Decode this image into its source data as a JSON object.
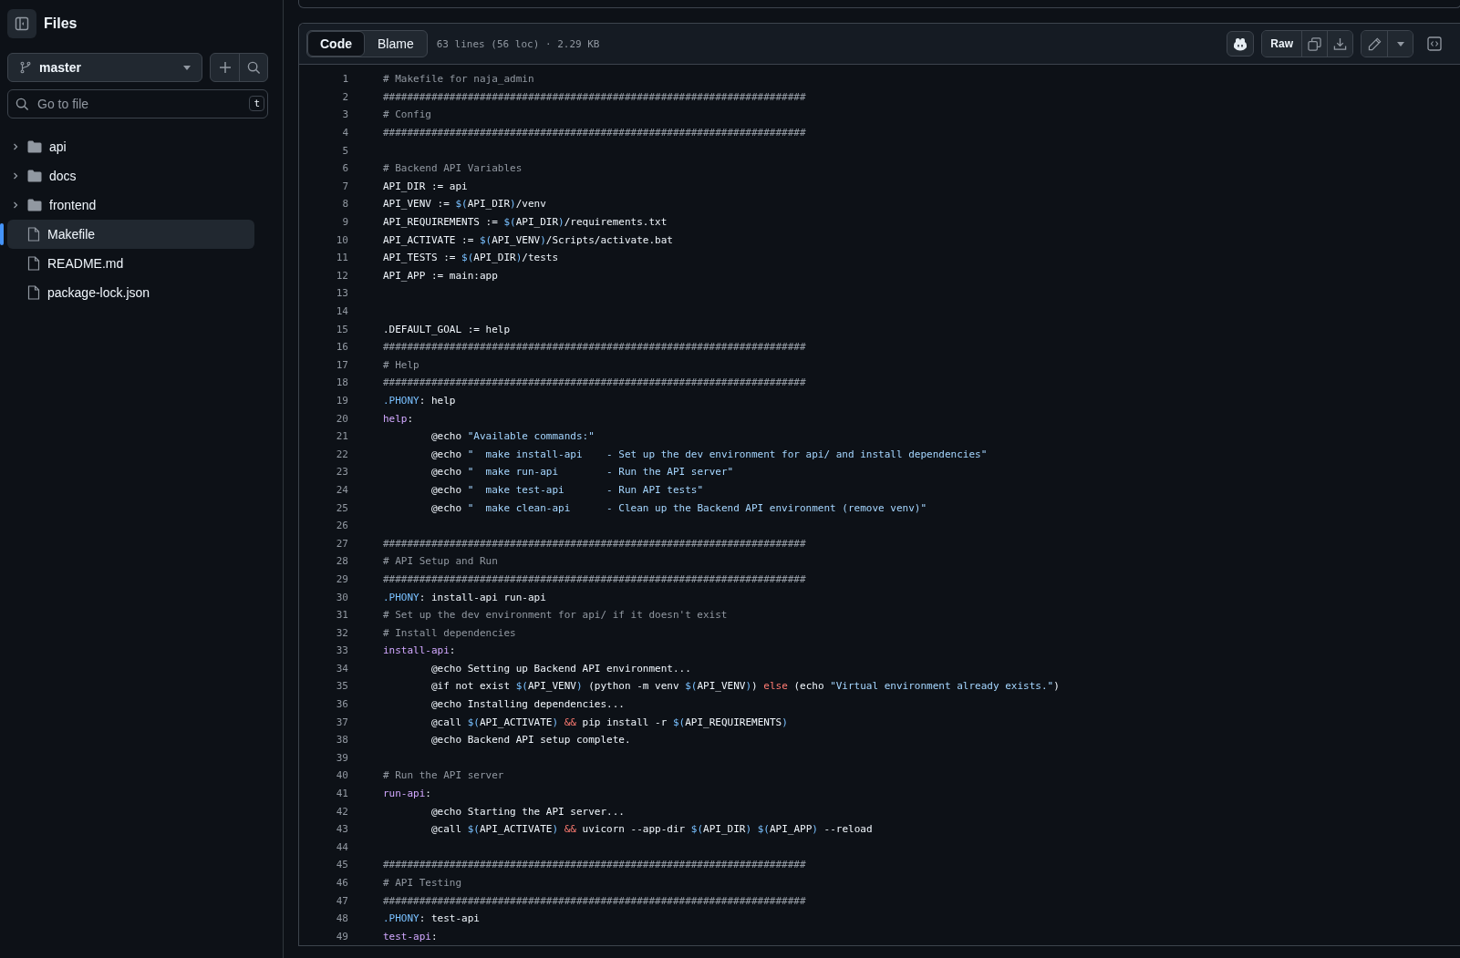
{
  "sidebar": {
    "title": "Files",
    "branch": "master",
    "search": {
      "placeholder": "Go to file",
      "shortcut": "t"
    },
    "items": [
      {
        "name": "api",
        "kind": "folder",
        "expanded": false,
        "selected": false
      },
      {
        "name": "docs",
        "kind": "folder",
        "expanded": false,
        "selected": false
      },
      {
        "name": "frontend",
        "kind": "folder",
        "expanded": false,
        "selected": false
      },
      {
        "name": "Makefile",
        "kind": "file",
        "selected": true
      },
      {
        "name": "README.md",
        "kind": "file",
        "selected": false
      },
      {
        "name": "package-lock.json",
        "kind": "file",
        "selected": false
      }
    ]
  },
  "file": {
    "tabs": [
      {
        "label": "Code",
        "selected": true
      },
      {
        "label": "Blame",
        "selected": false
      }
    ],
    "info": "63 lines (56 loc) · 2.29 KB",
    "raw_button": "Raw",
    "lines": [
      {
        "n": "1",
        "segs": [
          {
            "kind": "comment",
            "t": "# Makefile for naja_admin"
          }
        ]
      },
      {
        "n": "2",
        "segs": [
          {
            "kind": "comment",
            "t": "######################################################################"
          }
        ]
      },
      {
        "n": "3",
        "segs": [
          {
            "kind": "comment",
            "t": "# Config"
          }
        ]
      },
      {
        "n": "4",
        "segs": [
          {
            "kind": "comment",
            "t": "######################################################################"
          }
        ]
      },
      {
        "n": "5"
      },
      {
        "n": "6",
        "segs": [
          {
            "kind": "comment",
            "t": "# Backend API Variables"
          }
        ]
      },
      {
        "n": "7",
        "segs": [
          {
            "kind": "plain",
            "t": "API_DIR := api"
          }
        ]
      },
      {
        "n": "8",
        "segs": [
          {
            "kind": "plain",
            "t": "API_VENV := "
          },
          {
            "kind": "var",
            "t": "$("
          },
          {
            "kind": "plain",
            "t": "API_DIR"
          },
          {
            "kind": "var",
            "t": ")"
          },
          {
            "kind": "plain",
            "t": "/venv"
          }
        ]
      },
      {
        "n": "9",
        "segs": [
          {
            "kind": "plain",
            "t": "API_REQUIREMENTS := "
          },
          {
            "kind": "var",
            "t": "$("
          },
          {
            "kind": "plain",
            "t": "API_DIR"
          },
          {
            "kind": "var",
            "t": ")"
          },
          {
            "kind": "plain",
            "t": "/requirements.txt"
          }
        ]
      },
      {
        "n": "10",
        "segs": [
          {
            "kind": "plain",
            "t": "API_ACTIVATE := "
          },
          {
            "kind": "var",
            "t": "$("
          },
          {
            "kind": "plain",
            "t": "API_VENV"
          },
          {
            "kind": "var",
            "t": ")"
          },
          {
            "kind": "plain",
            "t": "/Scripts/activate.bat"
          }
        ]
      },
      {
        "n": "11",
        "segs": [
          {
            "kind": "plain",
            "t": "API_TESTS := "
          },
          {
            "kind": "var",
            "t": "$("
          },
          {
            "kind": "plain",
            "t": "API_DIR"
          },
          {
            "kind": "var",
            "t": ")"
          },
          {
            "kind": "plain",
            "t": "/tests"
          }
        ]
      },
      {
        "n": "12",
        "segs": [
          {
            "kind": "plain",
            "t": "API_APP := main:app"
          }
        ]
      },
      {
        "n": "13"
      },
      {
        "n": "14"
      },
      {
        "n": "15",
        "segs": [
          {
            "kind": "plain",
            "t": ".DEFAULT_GOAL := help"
          }
        ]
      },
      {
        "n": "16",
        "segs": [
          {
            "kind": "comment",
            "t": "######################################################################"
          }
        ]
      },
      {
        "n": "17",
        "segs": [
          {
            "kind": "comment",
            "t": "# Help"
          }
        ]
      },
      {
        "n": "18",
        "segs": [
          {
            "kind": "comment",
            "t": "######################################################################"
          }
        ]
      },
      {
        "n": "19",
        "segs": [
          {
            "kind": "keyword",
            "t": ".PHONY"
          },
          {
            "kind": "plain",
            "t": ": help"
          }
        ]
      },
      {
        "n": "20",
        "segs": [
          {
            "kind": "target",
            "t": "help"
          },
          {
            "kind": "plain",
            "t": ":"
          }
        ]
      },
      {
        "n": "21",
        "segs": [
          {
            "kind": "plain",
            "t": "\t@echo "
          },
          {
            "kind": "string",
            "t": "\"Available commands:\""
          }
        ]
      },
      {
        "n": "22",
        "segs": [
          {
            "kind": "plain",
            "t": "\t@echo "
          },
          {
            "kind": "string",
            "t": "\"  make install-api    - Set up the dev environment for api/ and install dependencies\""
          }
        ]
      },
      {
        "n": "23",
        "segs": [
          {
            "kind": "plain",
            "t": "\t@echo "
          },
          {
            "kind": "string",
            "t": "\"  make run-api        - Run the API server\""
          }
        ]
      },
      {
        "n": "24",
        "segs": [
          {
            "kind": "plain",
            "t": "\t@echo "
          },
          {
            "kind": "string",
            "t": "\"  make test-api       - Run API tests\""
          }
        ]
      },
      {
        "n": "25",
        "segs": [
          {
            "kind": "plain",
            "t": "\t@echo "
          },
          {
            "kind": "string",
            "t": "\"  make clean-api      - Clean up the Backend API environment (remove venv)\""
          }
        ]
      },
      {
        "n": "26"
      },
      {
        "n": "27",
        "segs": [
          {
            "kind": "comment",
            "t": "######################################################################"
          }
        ]
      },
      {
        "n": "28",
        "segs": [
          {
            "kind": "comment",
            "t": "# API Setup and Run"
          }
        ]
      },
      {
        "n": "29",
        "segs": [
          {
            "kind": "comment",
            "t": "######################################################################"
          }
        ]
      },
      {
        "n": "30",
        "segs": [
          {
            "kind": "keyword",
            "t": ".PHONY"
          },
          {
            "kind": "plain",
            "t": ": install-api run-api"
          }
        ]
      },
      {
        "n": "31",
        "segs": [
          {
            "kind": "comment",
            "t": "# Set up the dev environment for api/ if it doesn't exist"
          }
        ]
      },
      {
        "n": "32",
        "segs": [
          {
            "kind": "comment",
            "t": "# Install dependencies"
          }
        ]
      },
      {
        "n": "33",
        "segs": [
          {
            "kind": "target",
            "t": "install-api"
          },
          {
            "kind": "plain",
            "t": ":"
          }
        ]
      },
      {
        "n": "34",
        "segs": [
          {
            "kind": "plain",
            "t": "\t@echo Setting up Backend API environment..."
          }
        ]
      },
      {
        "n": "35",
        "segs": [
          {
            "kind": "plain",
            "t": "\t@if not exist "
          },
          {
            "kind": "var",
            "t": "$("
          },
          {
            "kind": "plain",
            "t": "API_VENV"
          },
          {
            "kind": "var",
            "t": ")"
          },
          {
            "kind": "plain",
            "t": " (python -m venv "
          },
          {
            "kind": "var",
            "t": "$("
          },
          {
            "kind": "plain",
            "t": "API_VENV"
          },
          {
            "kind": "var",
            "t": ")"
          },
          {
            "kind": "plain",
            "t": ") "
          },
          {
            "kind": "op",
            "t": "else"
          },
          {
            "kind": "plain",
            "t": " (echo "
          },
          {
            "kind": "string",
            "t": "\"Virtual environment already exists.\""
          },
          {
            "kind": "plain",
            "t": ")"
          }
        ]
      },
      {
        "n": "36",
        "segs": [
          {
            "kind": "plain",
            "t": "\t@echo Installing dependencies..."
          }
        ]
      },
      {
        "n": "37",
        "segs": [
          {
            "kind": "plain",
            "t": "\t@call "
          },
          {
            "kind": "var",
            "t": "$("
          },
          {
            "kind": "plain",
            "t": "API_ACTIVATE"
          },
          {
            "kind": "var",
            "t": ") "
          },
          {
            "kind": "op",
            "t": "&&"
          },
          {
            "kind": "plain",
            "t": " pip install -r "
          },
          {
            "kind": "var",
            "t": "$("
          },
          {
            "kind": "plain",
            "t": "API_REQUIREMENTS"
          },
          {
            "kind": "var",
            "t": ")"
          }
        ]
      },
      {
        "n": "38",
        "segs": [
          {
            "kind": "plain",
            "t": "\t@echo Backend API setup complete."
          }
        ]
      },
      {
        "n": "39"
      },
      {
        "n": "40",
        "segs": [
          {
            "kind": "comment",
            "t": "# Run the API server"
          }
        ]
      },
      {
        "n": "41",
        "segs": [
          {
            "kind": "target",
            "t": "run-api"
          },
          {
            "kind": "plain",
            "t": ":"
          }
        ]
      },
      {
        "n": "42",
        "segs": [
          {
            "kind": "plain",
            "t": "\t@echo Starting the API server..."
          }
        ]
      },
      {
        "n": "43",
        "segs": [
          {
            "kind": "plain",
            "t": "\t@call "
          },
          {
            "kind": "var",
            "t": "$("
          },
          {
            "kind": "plain",
            "t": "API_ACTIVATE"
          },
          {
            "kind": "var",
            "t": ") "
          },
          {
            "kind": "op",
            "t": "&&"
          },
          {
            "kind": "plain",
            "t": " uvicorn --app-dir "
          },
          {
            "kind": "var",
            "t": "$("
          },
          {
            "kind": "plain",
            "t": "API_DIR"
          },
          {
            "kind": "var",
            "t": ") $("
          },
          {
            "kind": "plain",
            "t": "API_APP"
          },
          {
            "kind": "var",
            "t": ")"
          },
          {
            "kind": "plain",
            "t": " --reload"
          }
        ]
      },
      {
        "n": "44"
      },
      {
        "n": "45",
        "segs": [
          {
            "kind": "comment",
            "t": "######################################################################"
          }
        ]
      },
      {
        "n": "46",
        "segs": [
          {
            "kind": "comment",
            "t": "# API Testing"
          }
        ]
      },
      {
        "n": "47",
        "segs": [
          {
            "kind": "comment",
            "t": "######################################################################"
          }
        ]
      },
      {
        "n": "48",
        "segs": [
          {
            "kind": "keyword",
            "t": ".PHONY"
          },
          {
            "kind": "plain",
            "t": ": test-api"
          }
        ]
      },
      {
        "n": "49",
        "segs": [
          {
            "kind": "target",
            "t": "test-api"
          },
          {
            "kind": "plain",
            "t": ":"
          }
        ]
      }
    ]
  }
}
